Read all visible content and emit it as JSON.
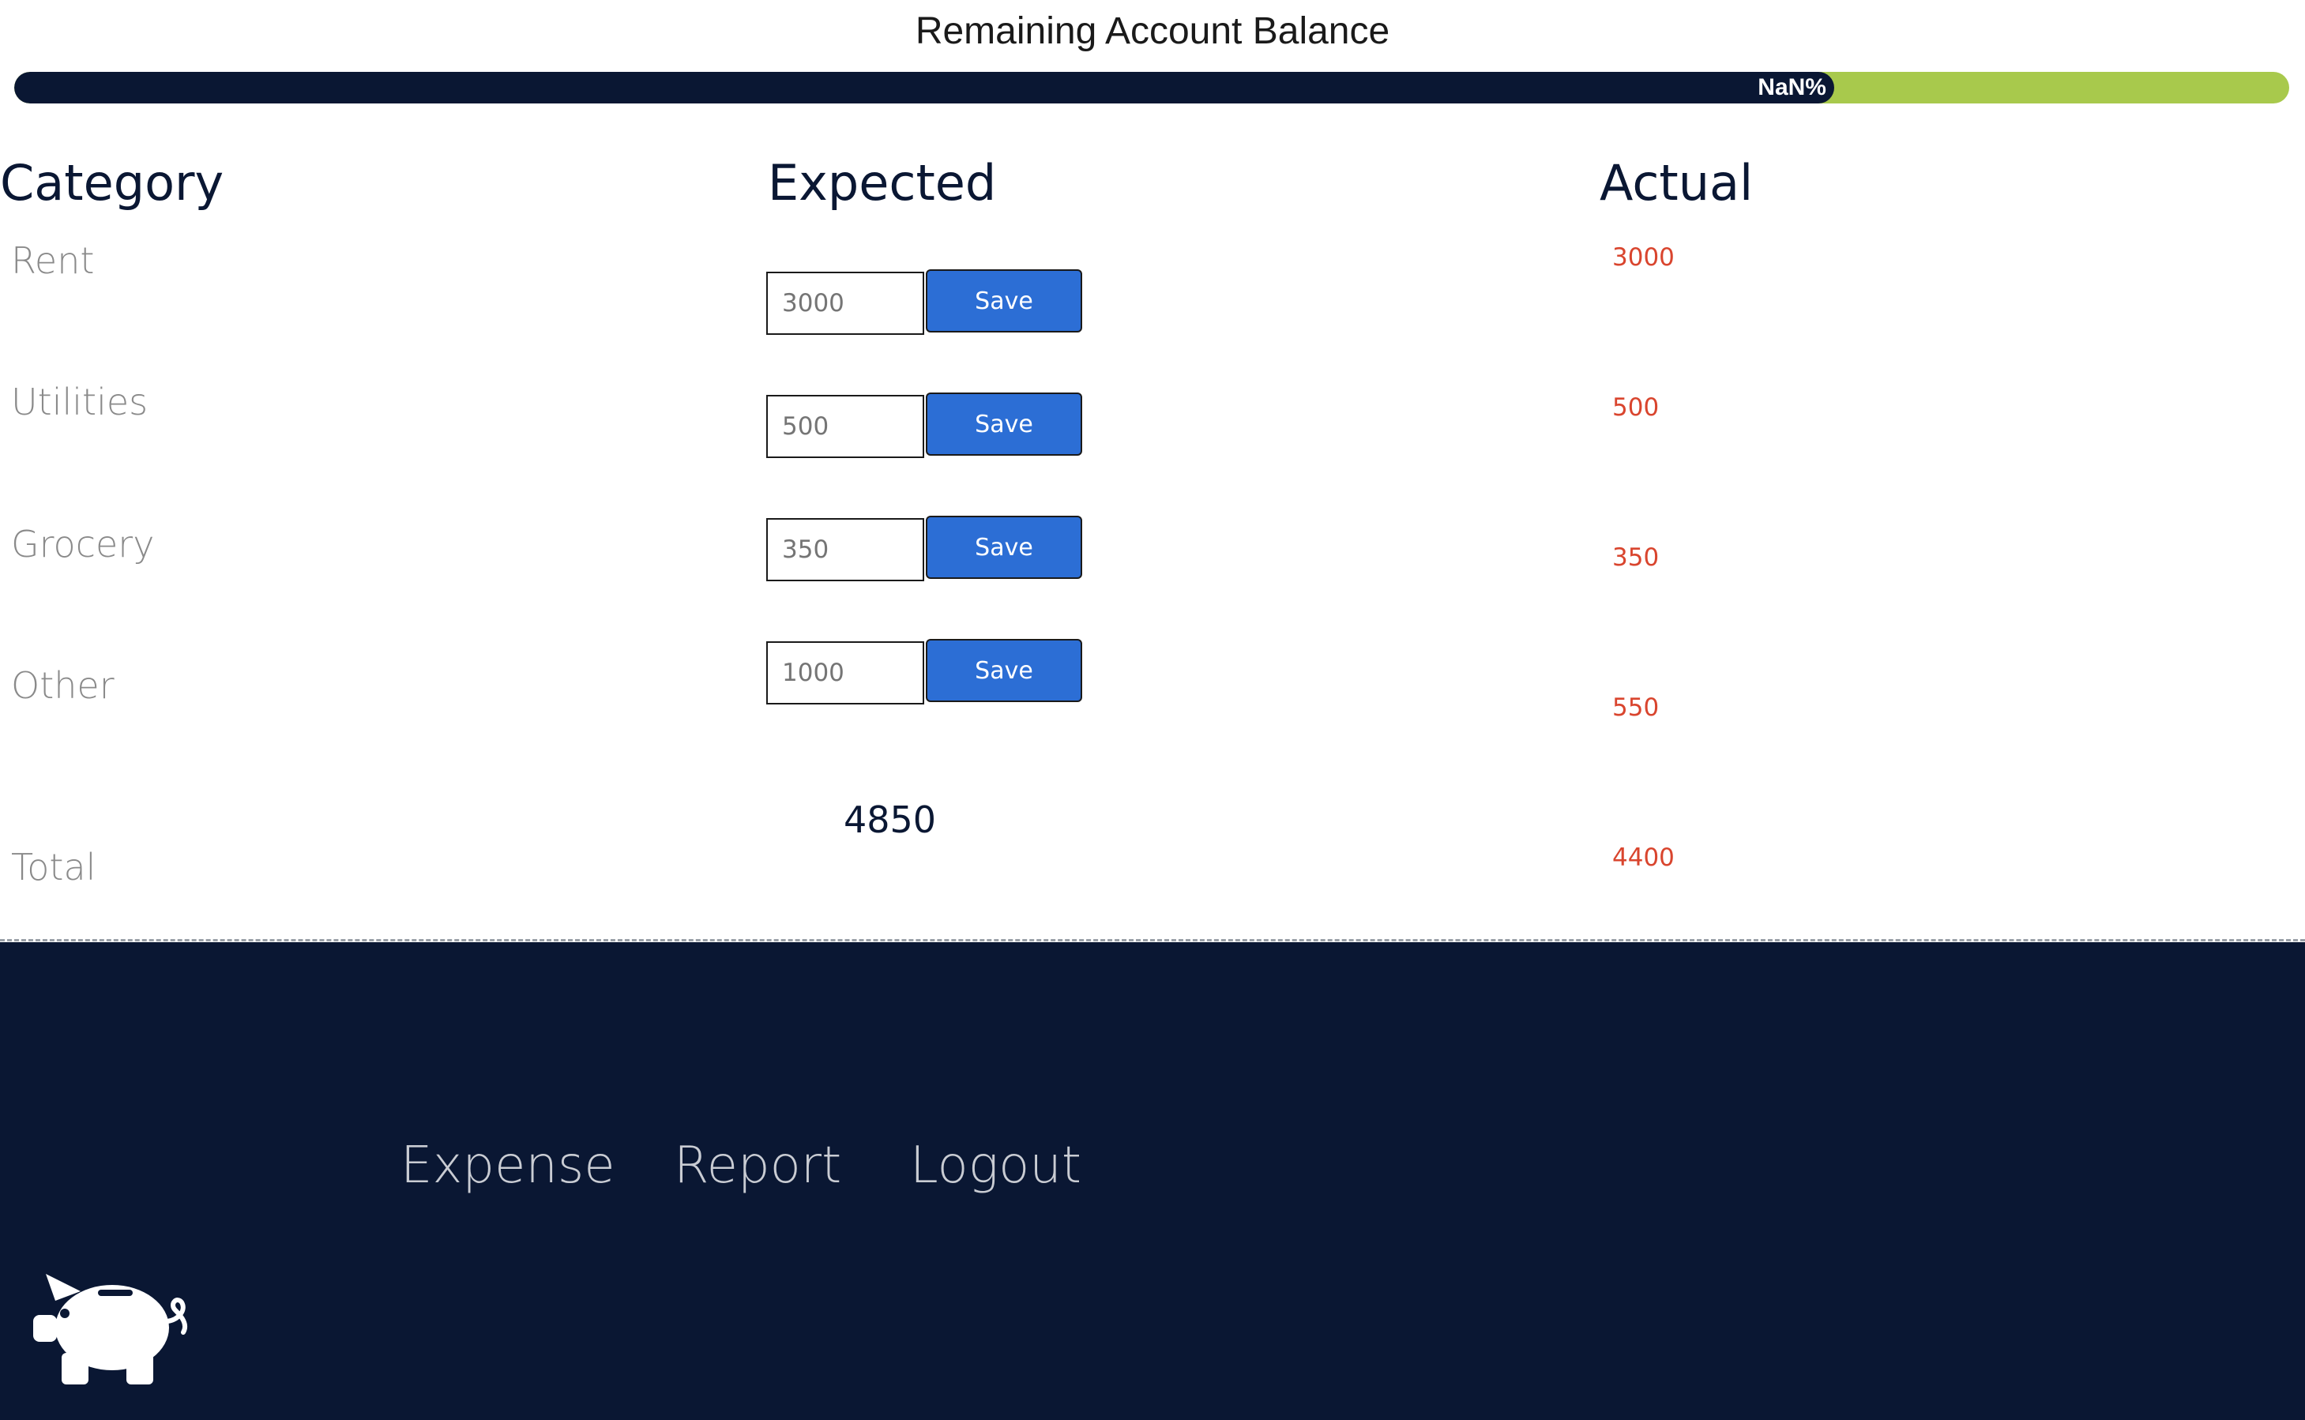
{
  "balance": {
    "title": "Remaining Account Balance",
    "progress_label": "NaN%",
    "progress_fraction": 0.8,
    "colors": {
      "filled": "#0a1733",
      "remaining": "#a8c94c"
    }
  },
  "headers": {
    "category": "Category",
    "expected": "Expected",
    "actual": "Actual"
  },
  "rows": [
    {
      "category": "Rent",
      "expected_value": "3000",
      "save_label": "Save",
      "actual": "3000"
    },
    {
      "category": "Utilities",
      "expected_value": "500",
      "save_label": "Save",
      "actual": "500"
    },
    {
      "category": "Grocery",
      "expected_value": "350",
      "save_label": "Save",
      "actual": "350"
    },
    {
      "category": "Other",
      "expected_value": "1000",
      "save_label": "Save",
      "actual": "550"
    }
  ],
  "total": {
    "label": "Total",
    "expected": "4850",
    "actual": "4400"
  },
  "nav": {
    "expense": "Expense",
    "report": "Report",
    "logout": "Logout"
  },
  "icons": {
    "logo": "piggy-bank-icon"
  },
  "colors": {
    "navy": "#0a1733",
    "button_blue": "#2c6ed5",
    "actual_red": "#d9452e",
    "progress_green": "#a8c94c"
  }
}
